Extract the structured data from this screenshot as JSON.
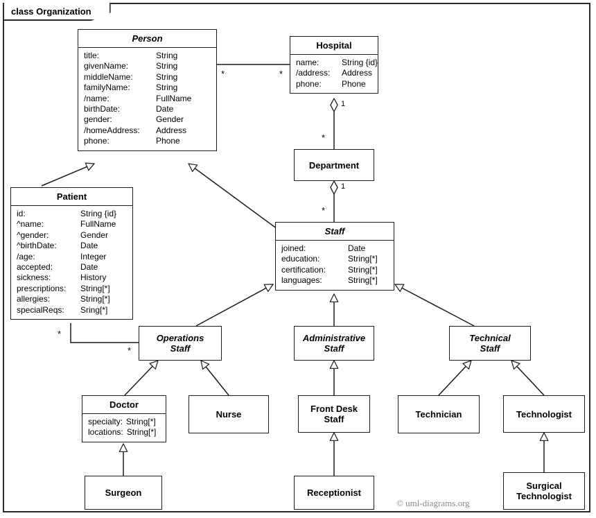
{
  "frame": {
    "label": "class Organization"
  },
  "copyright": "© uml-diagrams.org",
  "classes": {
    "person": {
      "name": "Person",
      "abstract": true,
      "attributes": [
        {
          "name": "title:",
          "type": "String"
        },
        {
          "name": "givenName:",
          "type": "String"
        },
        {
          "name": "middleName:",
          "type": "String"
        },
        {
          "name": "familyName:",
          "type": "String"
        },
        {
          "name": "/name:",
          "type": "FullName"
        },
        {
          "name": "birthDate:",
          "type": "Date"
        },
        {
          "name": "gender:",
          "type": "Gender"
        },
        {
          "name": "/homeAddress:",
          "type": "Address"
        },
        {
          "name": "phone:",
          "type": "Phone"
        }
      ]
    },
    "hospital": {
      "name": "Hospital",
      "abstract": false,
      "attributes": [
        {
          "name": "name:",
          "type": "String {id}"
        },
        {
          "name": "/address:",
          "type": "Address"
        },
        {
          "name": "phone:",
          "type": "Phone"
        }
      ]
    },
    "department": {
      "name": "Department",
      "abstract": false,
      "attributes": []
    },
    "patient": {
      "name": "Patient",
      "abstract": false,
      "attributes": [
        {
          "name": "id:",
          "type": "String {id}"
        },
        {
          "name": "^name:",
          "type": "FullName"
        },
        {
          "name": "^gender:",
          "type": "Gender"
        },
        {
          "name": "^birthDate:",
          "type": "Date"
        },
        {
          "name": "/age:",
          "type": "Integer"
        },
        {
          "name": "accepted:",
          "type": "Date"
        },
        {
          "name": "sickness:",
          "type": "History"
        },
        {
          "name": "prescriptions:",
          "type": "String[*]"
        },
        {
          "name": "allergies:",
          "type": "String[*]"
        },
        {
          "name": "specialReqs:",
          "type": "Sring[*]"
        }
      ]
    },
    "staff": {
      "name": "Staff",
      "abstract": true,
      "attributes": [
        {
          "name": "joined:",
          "type": "Date"
        },
        {
          "name": "education:",
          "type": "String[*]"
        },
        {
          "name": "certification:",
          "type": "String[*]"
        },
        {
          "name": "languages:",
          "type": "String[*]"
        }
      ]
    },
    "operations_staff": {
      "name": "Operations\nStaff",
      "name_line1": "Operations",
      "name_line2": "Staff",
      "abstract": true,
      "attributes": []
    },
    "administrative_staff": {
      "name_line1": "Administrative",
      "name_line2": "Staff",
      "abstract": true,
      "attributes": []
    },
    "technical_staff": {
      "name_line1": "Technical",
      "name_line2": "Staff",
      "abstract": true,
      "attributes": []
    },
    "doctor": {
      "name": "Doctor",
      "abstract": false,
      "attributes": [
        {
          "name": "specialty:",
          "type": "String[*]"
        },
        {
          "name": "locations:",
          "type": "String[*]"
        }
      ]
    },
    "nurse": {
      "name": "Nurse",
      "abstract": false,
      "attributes": []
    },
    "front_desk_staff": {
      "name_line1": "Front Desk",
      "name_line2": "Staff",
      "abstract": false,
      "attributes": []
    },
    "technician": {
      "name": "Technician",
      "abstract": false,
      "attributes": []
    },
    "technologist": {
      "name": "Technologist",
      "abstract": false,
      "attributes": []
    },
    "surgeon": {
      "name": "Surgeon",
      "abstract": false,
      "attributes": []
    },
    "receptionist": {
      "name": "Receptionist",
      "abstract": false,
      "attributes": []
    },
    "surgical_technologist": {
      "name_line1": "Surgical",
      "name_line2": "Technologist",
      "abstract": false,
      "attributes": []
    }
  },
  "multiplicities": {
    "person_hospital_person_end": "*",
    "person_hospital_hospital_end": "*",
    "hospital_department_hospital_end": "1",
    "hospital_department_department_end": "*",
    "department_staff_department_end": "1",
    "department_staff_staff_end": "*",
    "patient_opstaff_patient_end": "*",
    "patient_opstaff_opstaff_end": "*"
  }
}
